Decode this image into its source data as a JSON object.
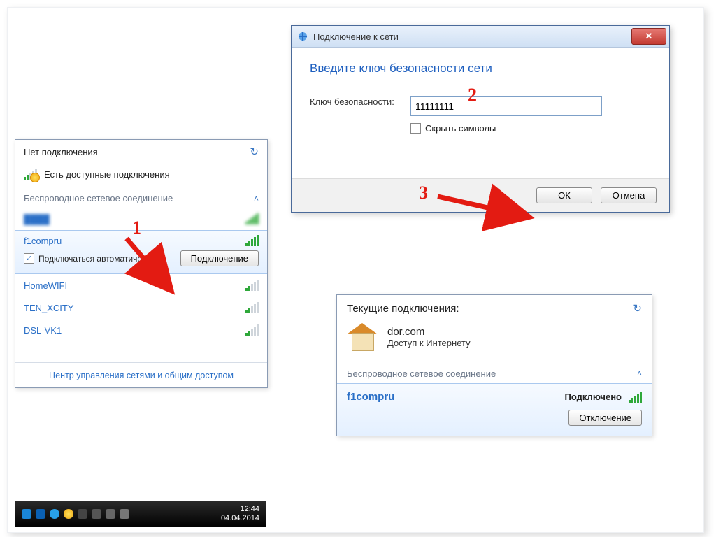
{
  "panelA": {
    "title": "Нет подключения",
    "status": "Есть доступные подключения",
    "section": "Беспроводное сетевое соединение",
    "blurred_name": "████",
    "selected": {
      "name": "f1compru",
      "auto_label": "Подключаться автоматически",
      "connect_btn": "Подключение"
    },
    "items": [
      {
        "name": "HomeWIFI"
      },
      {
        "name": "TEN_XCITY"
      },
      {
        "name": "DSL-VK1"
      }
    ],
    "footer_link": "Центр управления сетями и общим доступом"
  },
  "taskbar": {
    "time": "12:44",
    "date": "04.04.2014"
  },
  "panelB": {
    "window_title": "Подключение к сети",
    "heading": "Введите ключ безопасности сети",
    "key_label": "Ключ безопасности:",
    "key_value": "11111111",
    "hide_label": "Скрыть символы",
    "ok": "ОК",
    "cancel": "Отмена"
  },
  "panelC": {
    "head": "Текущие подключения:",
    "net_name": "dor.com",
    "net_status": "Доступ к Интернету",
    "section": "Беспроводное сетевое соединение",
    "conn_name": "f1compru",
    "conn_status": "Подключено",
    "disconnect": "Отключение"
  },
  "steps": {
    "s1": "1",
    "s2": "2",
    "s3": "3"
  }
}
